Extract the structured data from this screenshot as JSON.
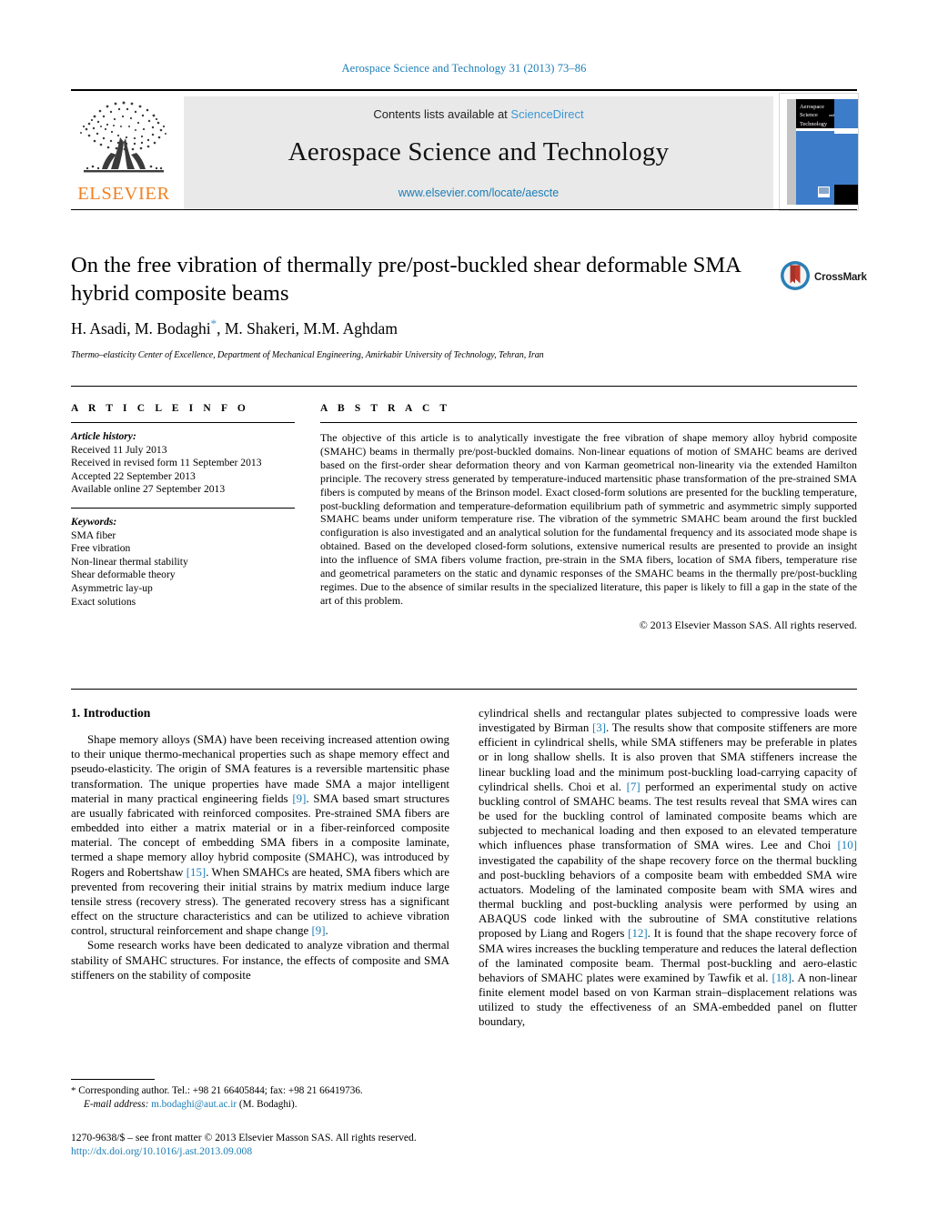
{
  "running_head": "Aerospace Science and Technology 31 (2013) 73–86",
  "masthead": {
    "contents_prefix": "Contents lists available at",
    "sciencedirect": "ScienceDirect",
    "journal_title": "Aerospace Science and Technology",
    "journal_url": "www.elsevier.com/locate/aescte",
    "publisher_wordmark": "ELSEVIER",
    "cover": {
      "line1": "Aerospace",
      "line2": "Science",
      "line3": "and",
      "line4": "Technology"
    }
  },
  "article": {
    "title": "On the free vibration of thermally pre/post-buckled shear deformable SMA hybrid composite beams",
    "authors": "H. Asadi, M. Bodaghi",
    "authors_tail": ", M. Shakeri, M.M. Aghdam",
    "author_star": "*",
    "affiliation": "Thermo–elasticity Center of Excellence, Department of Mechanical Engineering, Amirkabir University of Technology, Tehran, Iran",
    "crossmark_label": "CrossMark"
  },
  "article_info": {
    "heading": "A R T I C L E   I N F O",
    "history_label": "Article history:",
    "history": [
      "Received 11 July 2013",
      "Received in revised form 11 September 2013",
      "Accepted 22 September 2013",
      "Available online 27 September 2013"
    ],
    "keywords_label": "Keywords:",
    "keywords": [
      "SMA fiber",
      "Free vibration",
      "Non-linear thermal stability",
      "Shear deformable theory",
      "Asymmetric lay-up",
      "Exact solutions"
    ]
  },
  "abstract": {
    "heading": "A B S T R A C T",
    "text": "The objective of this article is to analytically investigate the free vibration of shape memory alloy hybrid composite (SMAHC) beams in thermally pre/post-buckled domains. Non-linear equations of motion of SMAHC beams are derived based on the first-order shear deformation theory and von Karman geometrical non-linearity via the extended Hamilton principle. The recovery stress generated by temperature-induced martensitic phase transformation of the pre-strained SMA fibers is computed by means of the Brinson model. Exact closed-form solutions are presented for the buckling temperature, post-buckling deformation and temperature-deformation equilibrium path of symmetric and asymmetric simply supported SMAHC beams under uniform temperature rise. The vibration of the symmetric SMAHC beam around the first buckled configuration is also investigated and an analytical solution for the fundamental frequency and its associated mode shape is obtained. Based on the developed closed-form solutions, extensive numerical results are presented to provide an insight into the influence of SMA fibers volume fraction, pre-strain in the SMA fibers, location of SMA fibers, temperature rise and geometrical parameters on the static and dynamic responses of the SMAHC beams in the thermally pre/post-buckling regimes. Due to the absence of similar results in the specialized literature, this paper is likely to fill a gap in the state of the art of this problem.",
    "copyright": "© 2013 Elsevier Masson SAS. All rights reserved."
  },
  "body": {
    "section_heading": "1. Introduction",
    "left_p1_a": "Shape memory alloys (SMA) have been receiving increased attention owing to their unique thermo-mechanical properties such as shape memory effect and pseudo-elasticity. The origin of SMA features is a reversible martensitic phase transformation. The unique properties have made SMA a major intelligent material in many practical engineering fields ",
    "left_p1_r1": "[9]",
    "left_p1_b": ". SMA based smart structures are usually fabricated with reinforced composites. Pre-strained SMA fibers are embedded into either a matrix material or in a fiber-reinforced composite material. The concept of embedding SMA fibers in a composite laminate, termed a shape memory alloy hybrid composite (SMAHC), was introduced by Rogers and Robertshaw ",
    "left_p1_r2": "[15]",
    "left_p1_c": ". When SMAHCs are heated, SMA fibers which are prevented from recovering their initial strains by matrix medium induce large tensile stress (recovery stress). The generated recovery stress has a significant effect on the structure characteristics and can be utilized to achieve vibration control, structural reinforcement and shape change ",
    "left_p1_r3": "[9]",
    "left_p1_d": ".",
    "left_p2": "Some research works have been dedicated to analyze vibration and thermal stability of SMAHC structures. For instance, the effects of composite and SMA stiffeners on the stability of composite",
    "right_a": "cylindrical shells and rectangular plates subjected to compressive loads were investigated by Birman ",
    "right_r1": "[3]",
    "right_b": ". The results show that composite stiffeners are more efficient in cylindrical shells, while SMA stiffeners may be preferable in plates or in long shallow shells. It is also proven that SMA stiffeners increase the linear buckling load and the minimum post-buckling load-carrying capacity of cylindrical shells. Choi et al. ",
    "right_r2": "[7]",
    "right_c": " performed an experimental study on active buckling control of SMAHC beams. The test results reveal that SMA wires can be used for the buckling control of laminated composite beams which are subjected to mechanical loading and then exposed to an elevated temperature which influences phase transformation of SMA wires. Lee and Choi ",
    "right_r3": "[10]",
    "right_d": " investigated the capability of the shape recovery force on the thermal buckling and post-buckling behaviors of a composite beam with embedded SMA wire actuators. Modeling of the laminated composite beam with SMA wires and thermal buckling and post-buckling analysis were performed by using an ABAQUS code linked with the subroutine of SMA constitutive relations proposed by Liang and Rogers ",
    "right_r4": "[12]",
    "right_e": ". It is found that the shape recovery force of SMA wires increases the buckling temperature and reduces the lateral deflection of the laminated composite beam. Thermal post-buckling and aero-elastic behaviors of SMAHC plates were examined by Tawfik et al. ",
    "right_r5": "[18]",
    "right_f": ". A non-linear finite element model based on von Karman strain–displacement relations was utilized to study the effectiveness of an SMA-embedded panel on flutter boundary,"
  },
  "footnotes": {
    "corresponding_star": "*",
    "corresponding": " Corresponding author. Tel.: +98 21 66405844; fax: +98 21 66419736.",
    "email_label": "E-mail address:",
    "email": "m.bodaghi@aut.ac.ir",
    "email_suffix": " (M. Bodaghi).",
    "imprint": "1270-9638/$ – see front matter © 2013 Elsevier Masson SAS. All rights reserved.",
    "doi": "http://dx.doi.org/10.1016/j.ast.2013.09.008"
  },
  "colors": {
    "link_blue": "#1a7db6",
    "sciencedirect_blue": "#3b97d3",
    "elsevier_orange": "#f08122",
    "band_grey": "#e9e9e9",
    "cover_blue": "#3d7cc9"
  }
}
